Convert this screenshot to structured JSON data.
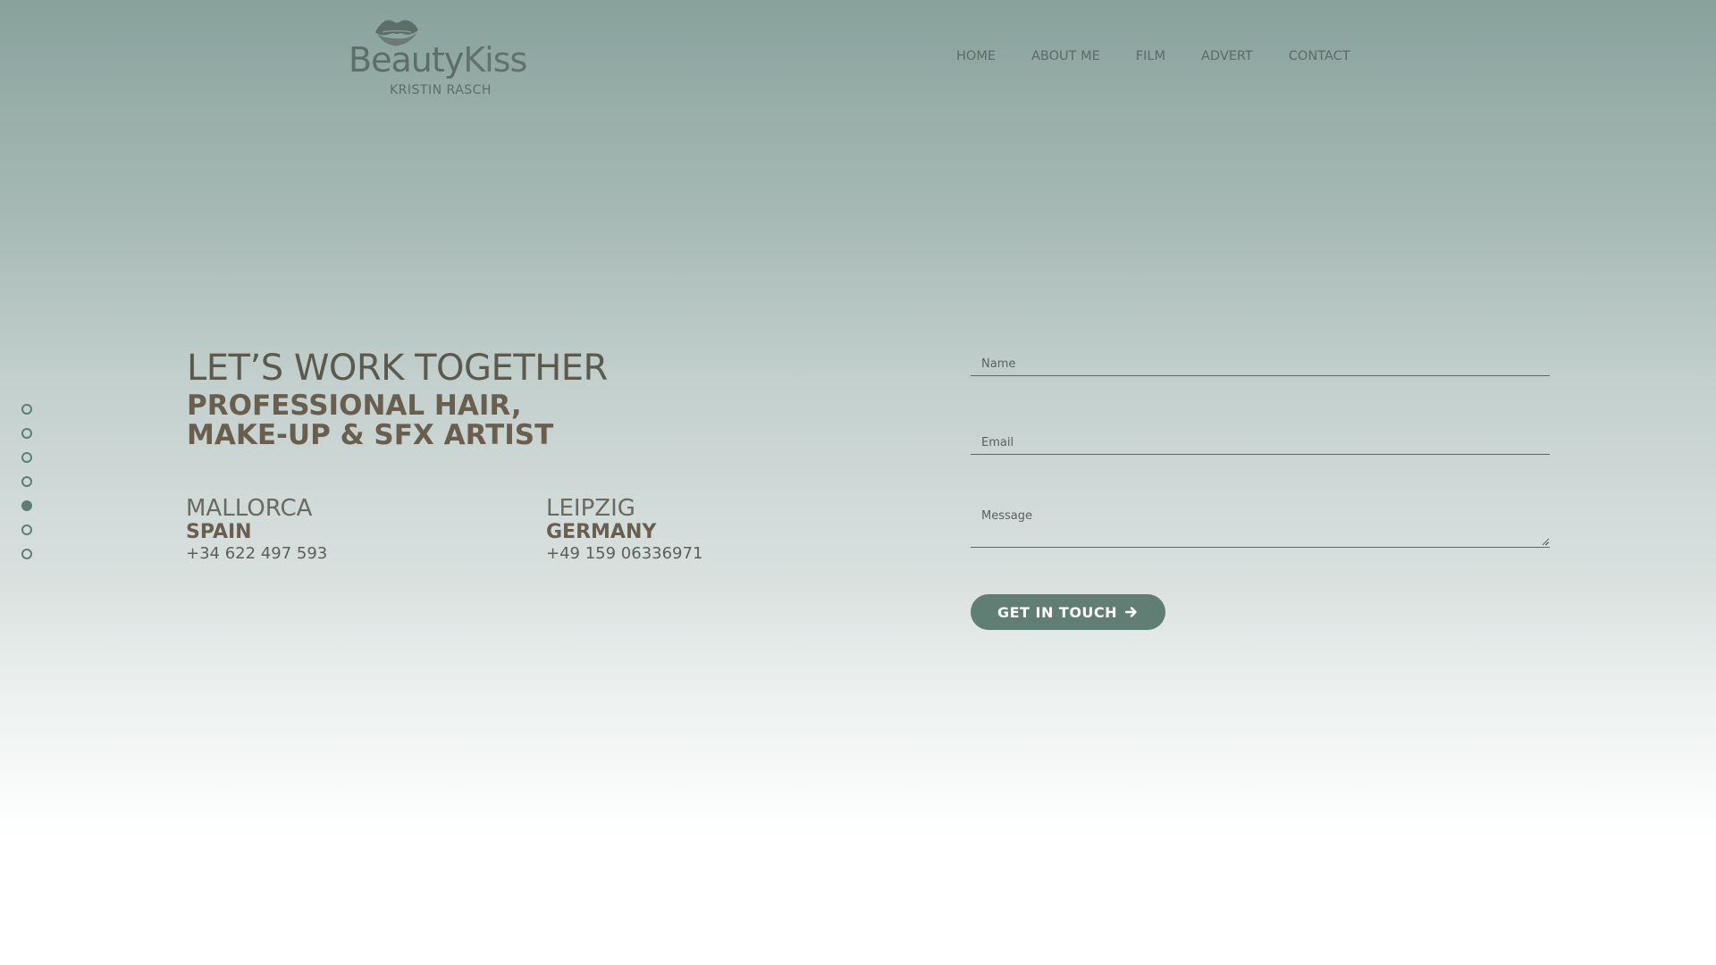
{
  "logo": {
    "wordmark_part1": "Beauty",
    "wordmark_part2": "Kiss",
    "tagline": "KRISTIN RASCH",
    "icon": "lips-icon"
  },
  "nav": {
    "items": [
      {
        "label": "HOME"
      },
      {
        "label": "ABOUT ME"
      },
      {
        "label": "FILM"
      },
      {
        "label": "ADVERT"
      },
      {
        "label": "CONTACT"
      }
    ]
  },
  "side_nav": {
    "dots": 7,
    "active_index": 4
  },
  "hero": {
    "headline": "LET’S WORK TOGETHER",
    "subline_1": "PROFESSIONAL HAIR,",
    "subline_2": "MAKE-UP & SFX ARTIST"
  },
  "locations": [
    {
      "city": "MALLORCA",
      "country": "SPAIN",
      "phone": "+34 622 497 593"
    },
    {
      "city": "LEIPZIG",
      "country": "GERMANY",
      "phone": "+49 159 06336971"
    }
  ],
  "form": {
    "name_placeholder": "Name",
    "name_value": "",
    "email_placeholder": "Email",
    "email_value": "",
    "message_placeholder": "Message",
    "message_value": "",
    "submit_label": "GET IN TOUCH",
    "submit_icon": "arrow-right-icon"
  },
  "colors": {
    "accent": "#617e75",
    "heading_brown": "#6a5f4e",
    "text_gray": "#5a5a50"
  }
}
